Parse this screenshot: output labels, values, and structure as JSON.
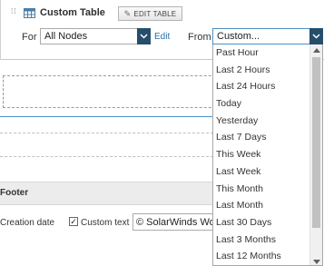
{
  "panel": {
    "title": "Custom Table",
    "edit_button_label": "EDIT TABLE"
  },
  "filters": {
    "for_label": "For",
    "nodes_value": "All Nodes",
    "edit_link": "Edit",
    "from_label": "From",
    "from_value": "Custom..."
  },
  "dropdown": {
    "options": [
      "Past Hour",
      "Last 2 Hours",
      "Last 24 Hours",
      "Today",
      "Yesterday",
      "Last 7 Days",
      "This Week",
      "Last Week",
      "This Month",
      "Last Month",
      "Last 30 Days",
      "Last 3 Months",
      "Last 12 Months"
    ]
  },
  "footer": {
    "label": "Footer",
    "creation_date_label": "Creation date",
    "custom_text_label": "Custom text",
    "custom_text_checked": true,
    "custom_text_value": "© SolarWinds Wor"
  },
  "colors": {
    "select_button": "#254e6b",
    "link": "#2b6fa8",
    "focus_border": "#4a90c8"
  },
  "icons": [
    "drag-handle-icon",
    "table-icon",
    "pencil-icon",
    "chevron-down-icon",
    "check-icon"
  ]
}
